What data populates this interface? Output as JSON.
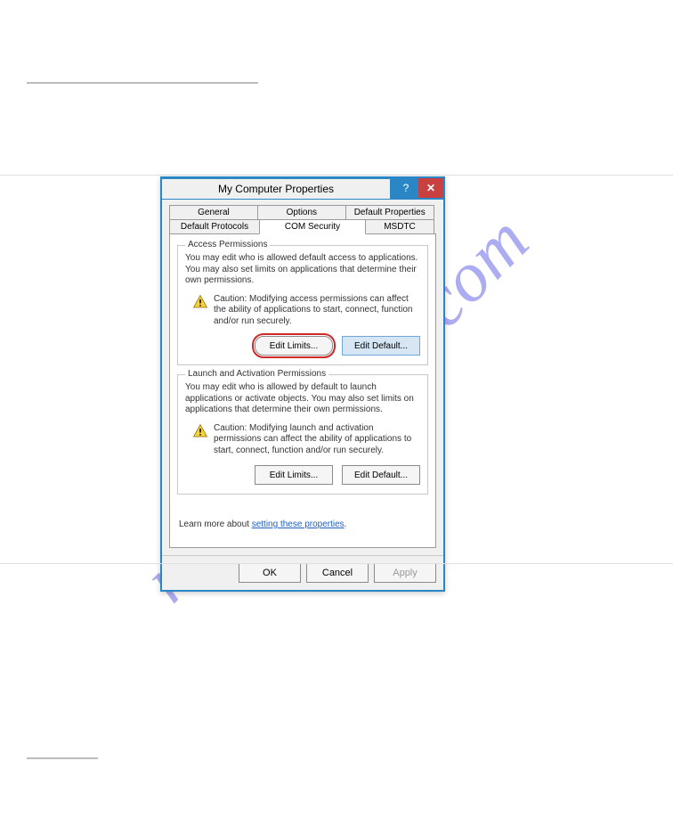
{
  "watermark": "manualshive.com",
  "dialog": {
    "title": "My Computer Properties",
    "tabs_row1": [
      "General",
      "Options",
      "Default Properties"
    ],
    "tabs_row2": [
      "Default Protocols",
      "COM Security",
      "MSDTC"
    ],
    "access": {
      "legend": "Access Permissions",
      "desc": "You may edit who is allowed default access to applications. You may also set limits on applications that determine their own permissions.",
      "caution": "Caution: Modifying access permissions can affect the ability of applications to start, connect, function and/or run securely.",
      "limits_btn": "Edit Limits...",
      "default_btn": "Edit Default..."
    },
    "launch": {
      "legend": "Launch and Activation Permissions",
      "desc": "You may edit who is allowed by default to launch applications or activate objects. You may also set limits on applications that determine their own permissions.",
      "caution": "Caution: Modifying launch and activation permissions can affect the ability of applications to start, connect, function and/or run securely.",
      "limits_btn": "Edit Limits...",
      "default_btn": "Edit Default..."
    },
    "learn_prefix": "Learn more about ",
    "learn_link": "setting these properties",
    "buttons": {
      "ok": "OK",
      "cancel": "Cancel",
      "apply": "Apply"
    }
  }
}
